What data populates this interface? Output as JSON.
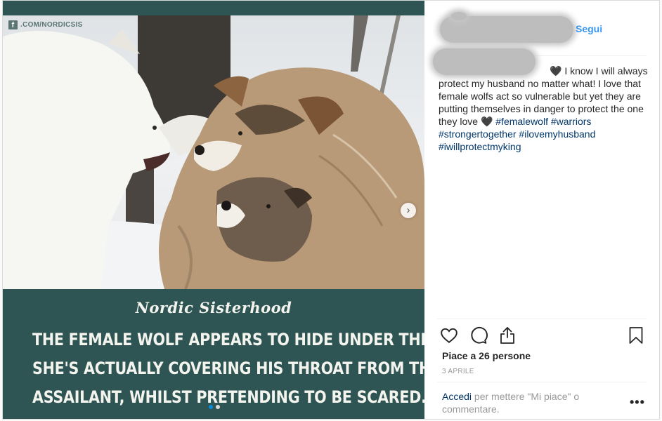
{
  "watermark": {
    "fb_glyph": "f",
    "text": ".COM/NORDICSIS"
  },
  "image_text": {
    "brand": "Nordic Sisterhood",
    "lines": [
      "THE FEMALE WOLF APPEARS TO HIDE UNDER THE MALE.",
      "SHE'S ACTUALLY COVERING HIS THROAT FROM THEIR",
      "ASSAILANT, WHILST PRETENDING TO BE SCARED."
    ]
  },
  "carousel": {
    "next_glyph": "›",
    "slide_count": 2,
    "active_index": 0
  },
  "post": {
    "follow_label": "Segui",
    "caption": {
      "heart_1": "🖤",
      "text_1": " I know I will always protect my husband no matter what! I love that female wolfs act so vulnerable but yet they are putting themselves in danger to protect the one they love ",
      "heart_2": "🖤",
      "hashtags": [
        "#femalewolf",
        "#warriors",
        "#strongertogether",
        "#ilovemyhusband",
        "#iwillprotectmyking"
      ]
    },
    "likes": "Piace a 26 persone",
    "date": "3 APRILE",
    "login_link": "Accedi",
    "login_rest": " per mettere \"Mi piace\" o commentare.",
    "more_glyph": "•••"
  },
  "icons": [
    "facebook-icon",
    "heart-icon",
    "comment-icon",
    "share-icon",
    "bookmark-icon",
    "chevron-right-icon",
    "more-icon"
  ],
  "colors": {
    "band": "#2e5454",
    "link": "#3897f0",
    "hashtag": "#003569"
  }
}
